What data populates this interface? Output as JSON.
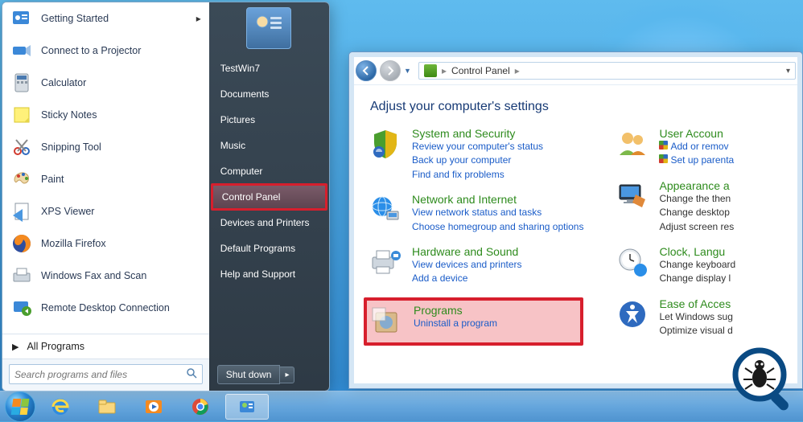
{
  "desktop": {
    "os_hint": "Windows 7"
  },
  "start_menu": {
    "pinned": [
      {
        "label": "Getting Started",
        "icon": "getting-started-icon",
        "has_submenu": true
      },
      {
        "label": "Connect to a Projector",
        "icon": "projector-icon"
      },
      {
        "label": "Calculator",
        "icon": "calculator-icon"
      },
      {
        "label": "Sticky Notes",
        "icon": "sticky-notes-icon"
      },
      {
        "label": "Snipping Tool",
        "icon": "snipping-tool-icon"
      },
      {
        "label": "Paint",
        "icon": "paint-icon"
      },
      {
        "label": "XPS Viewer",
        "icon": "xps-viewer-icon"
      },
      {
        "label": "Mozilla Firefox",
        "icon": "firefox-icon"
      },
      {
        "label": "Windows Fax and Scan",
        "icon": "fax-scan-icon"
      },
      {
        "label": "Remote Desktop Connection",
        "icon": "rdc-icon"
      }
    ],
    "all_programs_label": "All Programs",
    "search_placeholder": "Search programs and files",
    "right": {
      "username": "TestWin7",
      "items": [
        "Documents",
        "Pictures",
        "Music",
        "Computer",
        "Control Panel",
        "Devices and Printers",
        "Default Programs",
        "Help and Support"
      ],
      "highlight_index": 4
    },
    "shutdown_label": "Shut down"
  },
  "control_panel": {
    "breadcrumb": {
      "root": "Control Panel"
    },
    "title": "Adjust your computer's settings",
    "left_column": [
      {
        "name": "System and Security",
        "links": [
          "Review your computer's status",
          "Back up your computer",
          "Find and fix problems"
        ]
      },
      {
        "name": "Network and Internet",
        "links": [
          "View network status and tasks",
          "Choose homegroup and sharing options"
        ]
      },
      {
        "name": "Hardware and Sound",
        "links": [
          "View devices and printers",
          "Add a device"
        ]
      },
      {
        "name": "Programs",
        "links": [
          "Uninstall a program"
        ],
        "highlight": true
      }
    ],
    "right_column": [
      {
        "name": "User Accoun",
        "links": [
          "Add or remov",
          "Set up parenta"
        ],
        "shield": true
      },
      {
        "name": "Appearance a",
        "text": [
          "Change the then",
          "Change desktop",
          "Adjust screen res"
        ]
      },
      {
        "name": "Clock, Langu",
        "text": [
          "Change keyboard",
          "Change display l"
        ]
      },
      {
        "name": "Ease of Acces",
        "text": [
          "Let Windows sug",
          "Optimize visual d"
        ]
      }
    ]
  },
  "taskbar": {
    "items": [
      {
        "name": "start-orb"
      },
      {
        "name": "internet-explorer"
      },
      {
        "name": "file-explorer"
      },
      {
        "name": "windows-media-player"
      },
      {
        "name": "google-chrome"
      },
      {
        "name": "control-panel-task",
        "active": true
      }
    ]
  }
}
